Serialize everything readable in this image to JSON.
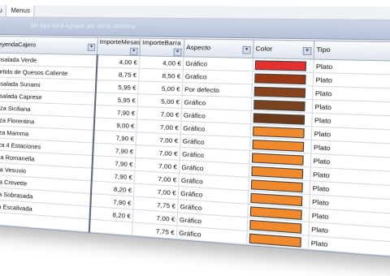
{
  "menubar": {
    "tabs": [
      "u",
      "Menus"
    ]
  },
  "groupbar": {
    "hint": "ste aquí para agrupar por dicha columna"
  },
  "columns": [
    "LeyendaCajero",
    "ImporteMesas",
    "ImporteBarra",
    "Aspecto",
    "Color",
    "Tipo"
  ],
  "rows": [
    {
      "name": "Ensalada Verde",
      "mesas": "4,00 €",
      "barra": "4,00 €",
      "aspecto": "Gráfico",
      "color": "#e53030",
      "tipo": "Plato"
    },
    {
      "name": "Surtido de Quesos Caliente",
      "mesas": "8,75 €",
      "barra": "8,50 €",
      "aspecto": "Gráfico",
      "color": "#9a3a14",
      "tipo": "Plato"
    },
    {
      "name": "Ensalada Sunami",
      "mesas": "5,95 €",
      "barra": "5,00 €",
      "aspecto": "Por defecto",
      "color": "#86421c",
      "tipo": "Plato"
    },
    {
      "name": "Ensalada Caprese",
      "mesas": "5,95 €",
      "barra": "5,00 €",
      "aspecto": "Gráfico",
      "color": "#7a4220",
      "tipo": "Plato"
    },
    {
      "name": "Pizza Siciliana",
      "mesas": "7,90 €",
      "barra": "7,00 €",
      "aspecto": "Gráfico",
      "color": "#6c3a1a",
      "tipo": "Plato"
    },
    {
      "name": "Pizza Florentina",
      "mesas": "9,00 €",
      "barra": "7,00 €",
      "aspecto": "Gráfico",
      "color": "#f08a2c",
      "tipo": "Plato"
    },
    {
      "name": "Pizza Mamma",
      "mesas": "7,90 €",
      "barra": "7,00 €",
      "aspecto": "Gráfico",
      "color": "#f08a2c",
      "tipo": "Plato"
    },
    {
      "name": "Pizza 4 Estaciones",
      "mesas": "7,90 €",
      "barra": "7,00 €",
      "aspecto": "Gráfico",
      "color": "#f08a2c",
      "tipo": "Plato"
    },
    {
      "name": "Pizza Romanella",
      "mesas": "7,90 €",
      "barra": "7,00 €",
      "aspecto": "Gráfico",
      "color": "#f08a2c",
      "tipo": "Plato"
    },
    {
      "name": "Pizza Vesuvio",
      "mesas": "7,90 €",
      "barra": "7,00 €",
      "aspecto": "Gráfico",
      "color": "#f08a2c",
      "tipo": "Plato"
    },
    {
      "name": "Pizza Crevette",
      "mesas": "8,20 €",
      "barra": "7,00 €",
      "aspecto": "Gráfico",
      "color": "#f08a2c",
      "tipo": "Plato"
    },
    {
      "name": "Pizza Sobrasada",
      "mesas": "7,90 €",
      "barra": "7,75 €",
      "aspecto": "Gráfico",
      "color": "#f08a2c",
      "tipo": "Plato"
    },
    {
      "name": "Pizza Escalivada",
      "mesas": "8,20 €",
      "barra": "7,00 €",
      "aspecto": "Gráfico",
      "color": "#f08a2c",
      "tipo": "Plato"
    },
    {
      "name": "",
      "mesas": "",
      "barra": "7,75 €",
      "aspecto": "Gráfico",
      "color": "#f08a2c",
      "tipo": "Plato"
    }
  ],
  "icons": {
    "dropdown": "chevron-down-icon"
  }
}
